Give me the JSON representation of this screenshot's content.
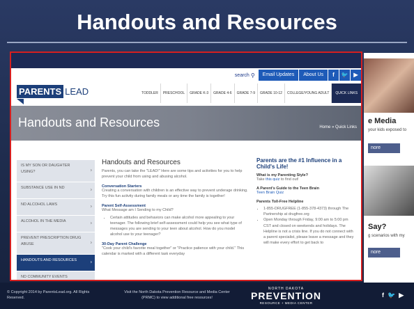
{
  "slide": {
    "title": "Handouts and Resources"
  },
  "site": {
    "util": {
      "search": "search",
      "email": "Email Updates",
      "about": "About Us"
    },
    "social": [
      "f",
      "t",
      "yt"
    ],
    "logo": {
      "a": "PARENTS",
      "b": "LEAD"
    },
    "nav": [
      "TODDLER",
      "PRESCHOOL",
      "GRADE K-3",
      "GRADE 4-6",
      "GRADE 7-9",
      "GRADE 10-12",
      "COLLEGE/YOUNG ADULT",
      "QUICK LINKS"
    ],
    "hero": {
      "title": "Handouts and Resources",
      "crumb": "Home » Quick Links"
    },
    "sidebar": [
      "IS MY SON OR DAUGHTER USING?",
      "SUBSTANCE USE IN ND",
      "ND ALCOHOL LAWS",
      "ALCOHOL IN THE MEDIA",
      "PREVENT PRESCRIPTION DRUG ABUSE",
      "HANDOUTS AND RESOURCES",
      "ND COMMUNITY EVENTS CALENDAR"
    ],
    "content": {
      "title": "Handouts and Resources",
      "intro": "Parents, you can take the \"LEAD!\" Here are some tips and activities for you to help prevent your child from using and abusing alcohol.",
      "h1": "Conversation Starters",
      "t1": "Creating a conversation with children is an effective way to prevent underage drinking. Try this fun activity during family meals or any time the family is together!",
      "h2": "Parent Self-Assessment",
      "t2": "What Message am I Sending to my Child?",
      "li": "Certain attitudes and behaviors can make alcohol more appealing to your teenager. The following brief self-assessment could help you see what type of messages you are sending to your teen about alcohol. How do you model alcohol use to your teenager?",
      "h3": "30-Day Parent Challenge",
      "t3": "\"Cook your child's favorite meal together\" or \"Practice patience with your child.\" This calendar is marked with a different task everyday"
    },
    "aside": {
      "title": "Parents are the #1 Influence in a Child's Life!",
      "h1": "What is my Parenting Style?",
      "t1_pre": "Take ",
      "t1_link": "this quiz",
      "t1_post": " to find out!",
      "h2": "A Parent's Guide to the Teen Brain",
      "t2": "Teen Brain Quiz",
      "h3": "Parents Toll-Free Helpline",
      "li1": "1-855-DRUGFREE (1-855-378-4373) through The Partnership at drugfree.org",
      "li2": "Open Monday through Friday, 9:00 am to 5:00 pm CST and closed on weekends and holidays. The Helpline is not a crisis line. If you do not connect with a parent specialist, please leave a message and they will make every effort to get back to"
    }
  },
  "peek": {
    "media": "e Media",
    "text1": "your kids exposed to",
    "btn1": "nore",
    "say": "Say?",
    "text2": "g scenarios with my",
    "btn2": "nore"
  },
  "footer": {
    "copyright": "© Copyright 2014 by ParentsLead.org. All Rights Reserved.",
    "visit": "Visit the North Dakota Prevention Resource and Media Center (PRMC) to view additional free resources!",
    "nd": "NORTH DAKOTA",
    "prevention": "PREVENTION",
    "rmc": "RESOURCE + MEDIA CENTER",
    "social": [
      "f",
      "t",
      "yt"
    ]
  }
}
